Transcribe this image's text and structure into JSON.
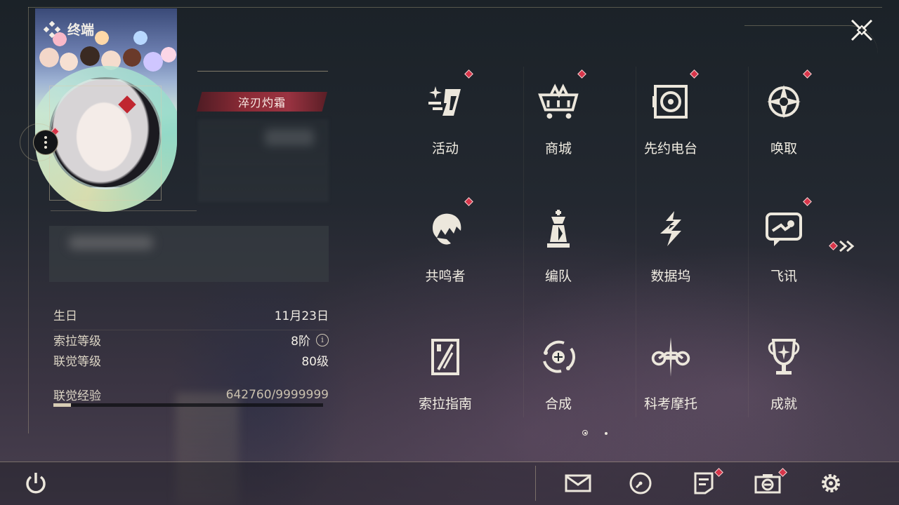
{
  "header": {
    "title": "终端"
  },
  "profile": {
    "title_tag": "淬刃灼霜",
    "stats": {
      "birthday_label": "生日",
      "birthday_value": "11月23日",
      "sola_level_label": "索拉等级",
      "sola_level_value": "8阶",
      "union_level_label": "联觉等级",
      "union_level_value": "80级",
      "union_exp_label": "联觉经验",
      "union_exp_value": "642760/9999999",
      "union_exp_progress": 0.0643
    }
  },
  "menu": {
    "items": [
      {
        "label": "活动",
        "icon": "activity-icon",
        "notify": true
      },
      {
        "label": "商城",
        "icon": "shop-cart-icon",
        "notify": true
      },
      {
        "label": "先约电台",
        "icon": "radio-icon",
        "notify": true
      },
      {
        "label": "唤取",
        "icon": "convene-icon",
        "notify": true
      },
      {
        "label": "共鸣者",
        "icon": "resonator-icon",
        "notify": true
      },
      {
        "label": "编队",
        "icon": "team-chess-icon",
        "notify": false
      },
      {
        "label": "数据坞",
        "icon": "data-bank-icon",
        "notify": false
      },
      {
        "label": "飞讯",
        "icon": "chat-icon",
        "notify": true
      },
      {
        "label": "索拉指南",
        "icon": "guide-book-icon",
        "notify": false
      },
      {
        "label": "合成",
        "icon": "synthesis-icon",
        "notify": false
      },
      {
        "label": "科考摩托",
        "icon": "motorcycle-icon",
        "notify": false
      },
      {
        "label": "成就",
        "icon": "trophy-icon",
        "notify": false
      }
    ],
    "page": {
      "current": 1,
      "total": 2
    }
  },
  "colors": {
    "accent_gold": "#d8cdb5",
    "notify_red": "#d8354a",
    "tag_red": "#8a2a35"
  },
  "bottom_bar": {
    "icons": [
      "power-icon",
      "mail-icon",
      "clock-icon",
      "notice-icon",
      "camera-icon",
      "settings-gear-icon"
    ]
  }
}
